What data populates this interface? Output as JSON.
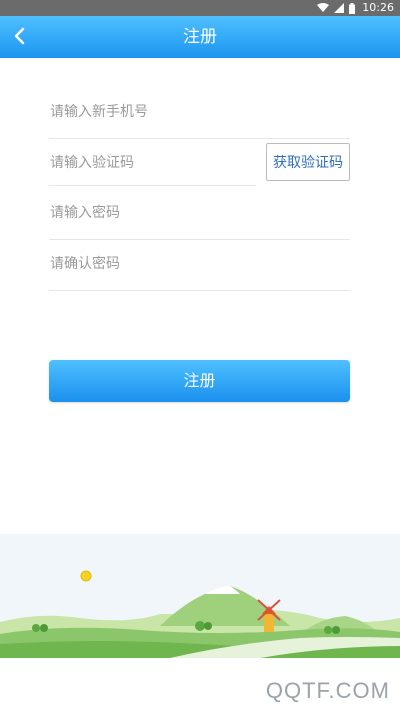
{
  "status_bar": {
    "time": "10:26",
    "icons": [
      "wifi-icon",
      "signal-icon",
      "battery-icon"
    ]
  },
  "header": {
    "title": "注册",
    "back_icon": "chevron-left-icon"
  },
  "form": {
    "phone_placeholder": "请输入新手机号",
    "code_placeholder": "请输入验证码",
    "get_code_label": "获取验证码",
    "password_placeholder": "请输入密码",
    "confirm_password_placeholder": "请确认密码"
  },
  "register_button": {
    "label": "注册"
  },
  "watermark": "QQTF.COM",
  "colors": {
    "header_gradient_top": "#4fc0ff",
    "header_gradient_bottom": "#1b95ef",
    "button_text_blue": "#2d6fb8"
  }
}
